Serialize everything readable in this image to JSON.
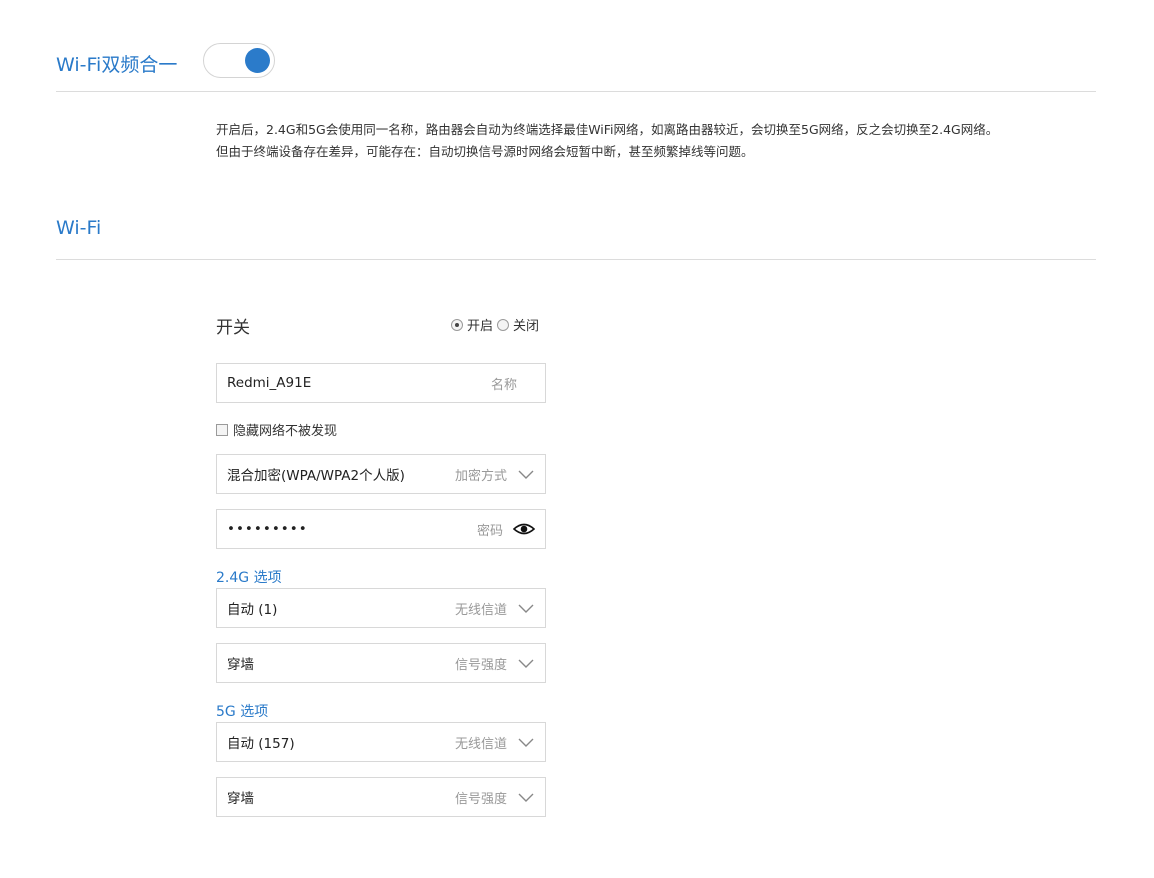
{
  "dual_band": {
    "title": "Wi-Fi双频合一",
    "enabled": true,
    "description_line1": "开启后，2.4G和5G会使用同一名称，路由器会自动为终端选择最佳WiFi网络，如离路由器较近，会切换至5G网络，反之会切换至2.4G网络。",
    "description_line2": "但由于终端设备存在差异，可能存在：自动切换信号源时网络会短暂中断，甚至频繁掉线等问题。"
  },
  "wifi": {
    "title": "Wi-Fi",
    "switch_label": "开关",
    "radio_on": "开启",
    "radio_off": "关闭",
    "selected": "on",
    "name_value": "Redmi_A91E",
    "name_hint": "名称",
    "hide_label": "隐藏网络不被发现",
    "hide_checked": false,
    "encryption_value": "混合加密(WPA/WPA2个人版)",
    "encryption_hint": "加密方式",
    "password_value": "•••••••••",
    "password_hint": "密码",
    "band_24": {
      "title": "2.4G 选项",
      "channel_value": "自动 (1)",
      "channel_hint": "无线信道",
      "strength_value": "穿墙",
      "strength_hint": "信号强度"
    },
    "band_5": {
      "title": "5G 选项",
      "channel_value": "自动 (157)",
      "channel_hint": "无线信道",
      "strength_value": "穿墙",
      "strength_hint": "信号强度"
    }
  },
  "icons": {
    "toggle_color": "#2b7bca",
    "accent": "#2a7ac9"
  }
}
